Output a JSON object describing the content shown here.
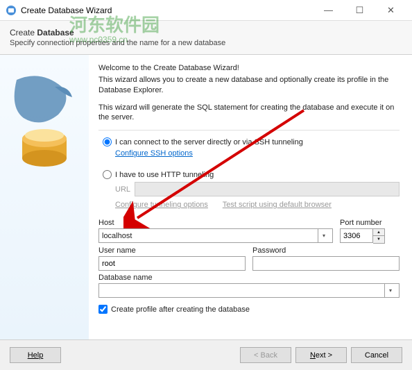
{
  "window": {
    "title": "Create Database Wizard"
  },
  "watermark": {
    "text": "河东软件园",
    "url": "www.pc0359.cn"
  },
  "header": {
    "title_prefix": "Create ",
    "title_bold": "Database",
    "subtitle": "Specify connection properties and the name for a new database"
  },
  "intro": {
    "p1": "Welcome to the Create Database Wizard!",
    "p2": "This wizard allows you to create a new database and optionally create its profile in the Database Explorer.",
    "p3": "This wizard will generate the SQL statement for creating the database and execute it on the server."
  },
  "connection": {
    "radio_direct": "I can connect to the server directly or via SSH tunneling",
    "configure_ssh": "Configure SSH options",
    "radio_http": "I have to use HTTP tunneling",
    "url_label": "URL",
    "url_value": "",
    "configure_tunneling": "Configure tunneling options",
    "test_script": "Test script using default browser"
  },
  "form": {
    "host_label": "Host",
    "host_value": "localhost",
    "port_label": "Port number",
    "port_value": "3306",
    "user_label": "User name",
    "user_value": "root",
    "password_label": "Password",
    "password_value": "",
    "dbname_label": "Database name",
    "dbname_value": ""
  },
  "checkbox": {
    "create_profile": "Create profile after creating the database"
  },
  "buttons": {
    "help": "Help",
    "back": "< Back",
    "next": "Next >",
    "cancel": "Cancel"
  }
}
